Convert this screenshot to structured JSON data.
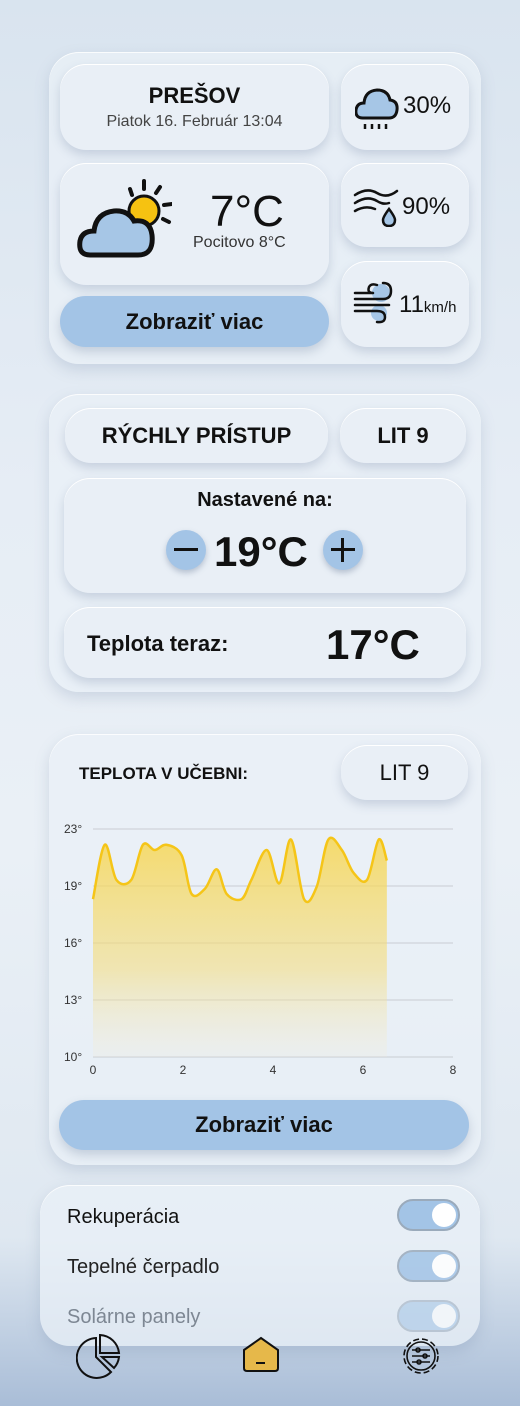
{
  "weather": {
    "city": "PREŠOV",
    "datetime": "Piatok 16. Február 13:04",
    "temperature": "7°C",
    "feels_like": "Pocitovo 8°C",
    "more_label": "Zobraziť viac",
    "rain_chance": "30%",
    "humidity": "90%",
    "wind_value": "11",
    "wind_unit": "km/h",
    "icons": [
      "partly-cloudy-icon",
      "rain-cloud-icon",
      "humidity-icon",
      "wind-icon"
    ]
  },
  "quick_access": {
    "title": "RÝCHLY PRÍSTUP",
    "room": "LIT 9",
    "set_label": "Nastavené na:",
    "set_value": "19°C",
    "current_label": "Teplota teraz:",
    "current_value": "17°C"
  },
  "classroom": {
    "title": "TEPLOTA V UČEBNI:",
    "room": "LIT 9",
    "more_label": "Zobraziť viac"
  },
  "chart_data": {
    "type": "area",
    "title": "",
    "xlabel": "",
    "ylabel": "",
    "xlim": [
      0,
      8
    ],
    "ylim": [
      10,
      23
    ],
    "x_ticks": [
      "0",
      "2",
      "4",
      "6",
      "8"
    ],
    "y_ticks": [
      "10°",
      "13°",
      "16°",
      "19°",
      "23°"
    ],
    "grid": "horizontal",
    "color": "#f5c518",
    "x": [
      0,
      0.26,
      0.52,
      0.85,
      1.11,
      1.37,
      1.63,
      1.97,
      2.19,
      2.49,
      2.75,
      2.97,
      3.3,
      3.52,
      3.86,
      4.14,
      4.4,
      4.69,
      4.97,
      5.23,
      5.53,
      5.79,
      6.09,
      6.35,
      6.53
    ],
    "y": [
      19.0,
      22.1,
      20.1,
      20.1,
      22.1,
      21.8,
      22.1,
      21.5,
      19.3,
      19.6,
      20.7,
      19.3,
      19.0,
      20.1,
      21.8,
      19.9,
      22.4,
      19.0,
      19.7,
      22.4,
      21.8,
      20.5,
      20.1,
      22.4,
      21.2
    ]
  },
  "toggles": [
    {
      "label": "Rekuperácia",
      "on": true
    },
    {
      "label": "Tepelné čerpadlo",
      "on": true
    },
    {
      "label": "Solárne panely",
      "on": true
    }
  ],
  "nav": {
    "items": [
      "stats-icon",
      "home-icon",
      "settings-icon"
    ],
    "active": "home-icon",
    "accent": "#e6b84a"
  }
}
